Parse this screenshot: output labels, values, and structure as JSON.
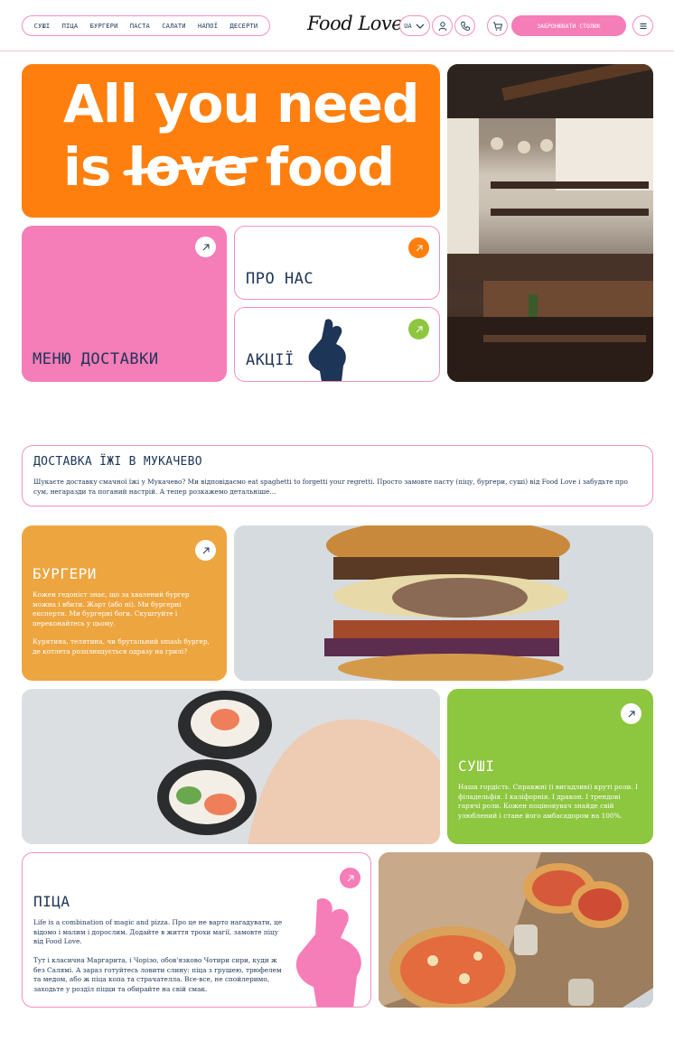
{
  "nav": {
    "items": [
      "СУШІ",
      "ПІЦА",
      "БУРГЕРИ",
      "ПАСТА",
      "САЛАТИ",
      "НАПОЇ",
      "ДЕСЕРТИ"
    ]
  },
  "header": {
    "logo": "Food Love",
    "lang": "UA",
    "book_label": "ЗАБРОНЮВАТИ СТОЛИК"
  },
  "hero": {
    "line1": "All you need",
    "line2_start": "is",
    "line2_struck": "love",
    "line2_end": "food"
  },
  "tiles": {
    "menu_label": "МЕНЮ ДОСТАВКИ",
    "about_label": "ПРО НАС",
    "promo_label": "АКЦІЇ"
  },
  "delivery": {
    "title": "ДОСТАВКА ЇЖІ В МУКАЧЕВО",
    "text": "Шукаєте доставку смачної їжі у Мукачево? Ми відповідаємо eat spaghetti to forgetti your regretti. Просто замовте пасту (піцу, бургери, суші) від Food Love і забудьте про сум, негаразди та поганий настрій. А тепер розкажемо детальніше..."
  },
  "burgers": {
    "title": "БУРГЕРИ",
    "text1": "Кожен гедоніст знає, що за хвалений бургер можна і вбити. Жарт (або ні). Ми бургерні експерти. Ми бургерні боги. Скуштуйте і переконайтесь у цьому.",
    "text2": "Курятина, телятина, чи брутальний smash бургер, де котлета розплющується одразу на грилі?"
  },
  "sushi": {
    "title": "СУШІ",
    "text": "Наша гордість. Справжні (і вигадливі) круті роли. І філадельфія. І каліфорнія. І дракон. І трендові гарячі роли. Кожен поціновувач знайде свій улюблений і стане його амбасадором на 100%."
  },
  "pizza": {
    "title": "ПІЦА",
    "text1": "Life is a combination of magic and pizza. Про це не варто нагадувати, це відомо і малим і дорослим. Додайте в життя трохи магії, замовте піцу від Food Love.",
    "text2": "Тут і класична Маргарита, і Чорізо, обов'язково Чотири сири, куди ж без Салямі. А зараз готуйтесь ловити слину: піца з грушею, трюфелем та медом, або ж піца копа та страчателла. Все-все, не спойлеримо, заходьте у розділ піцци та обирайте на свій смак."
  },
  "colors": {
    "orange": "#ff7f0e",
    "pink": "#f57db8",
    "burger": "#eda540",
    "green": "#8dc63f",
    "navy": "#1d3557"
  }
}
